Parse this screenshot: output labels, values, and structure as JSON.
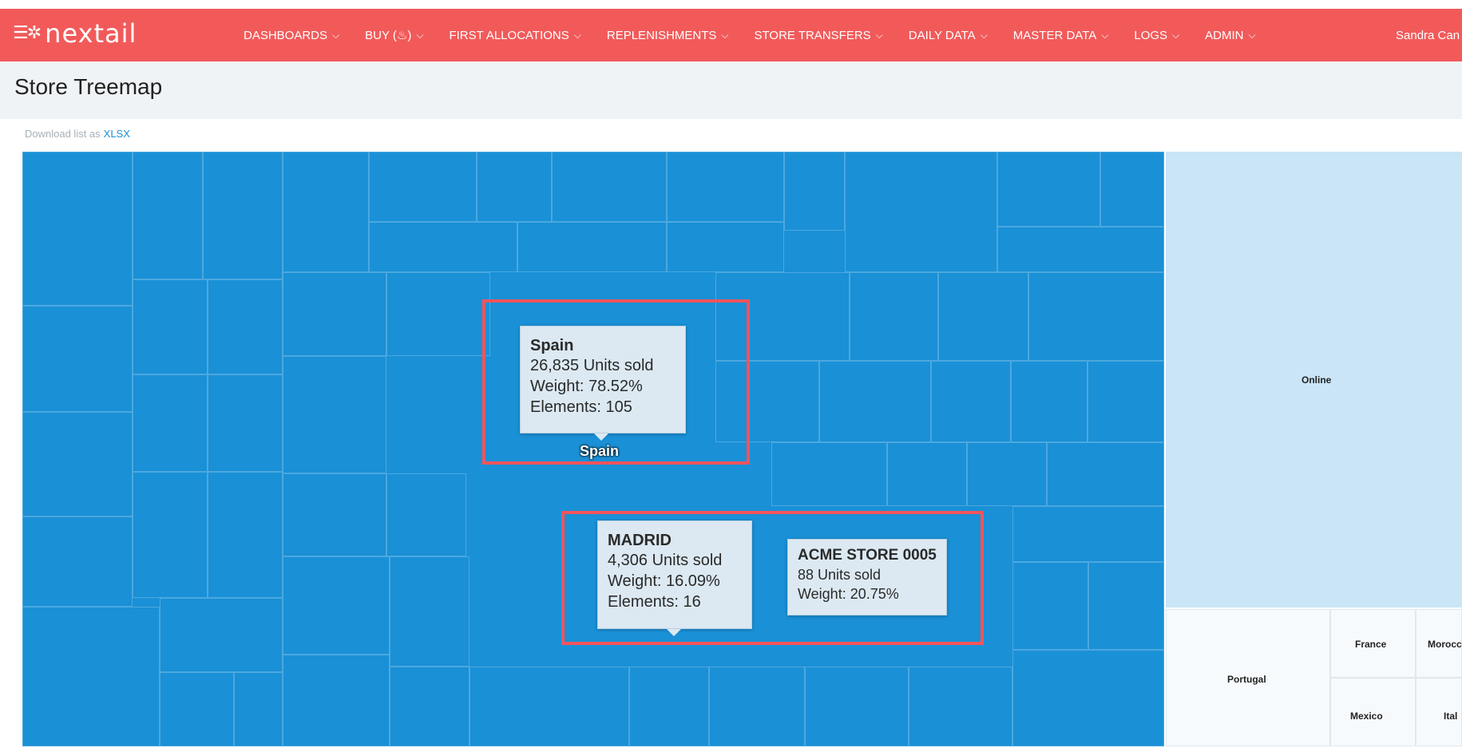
{
  "brand": {
    "name": "nextail",
    "icon": "logo-icon"
  },
  "nav": {
    "items": [
      {
        "label": "DASHBOARDS"
      },
      {
        "label": "BUY (♨)"
      },
      {
        "label": "FIRST ALLOCATIONS"
      },
      {
        "label": "REPLENISHMENTS"
      },
      {
        "label": "STORE TRANSFERS"
      },
      {
        "label": "DAILY DATA"
      },
      {
        "label": "MASTER DATA"
      },
      {
        "label": "LOGS"
      },
      {
        "label": "ADMIN"
      }
    ],
    "user": "Sandra Can"
  },
  "page": {
    "title": "Store Treemap",
    "download_prefix": "Download list as",
    "download_link": "XLSX"
  },
  "treemap": {
    "regions": [
      {
        "label": "Online"
      },
      {
        "label": "Portugal"
      },
      {
        "label": "France"
      },
      {
        "label": "Morocc"
      },
      {
        "label": "Mexico"
      },
      {
        "label": "Ital"
      }
    ],
    "spain_label": "Spain",
    "tooltips": {
      "spain": {
        "title": "Spain",
        "units": "26,835 Units sold",
        "weight": "Weight: 78.52%",
        "elements": "Elements: 105"
      },
      "madrid": {
        "title": "MADRID",
        "units": "4,306 Units sold",
        "weight": "Weight: 16.09%",
        "elements": "Elements: 16"
      },
      "store": {
        "title": "ACME STORE 0005",
        "units": "88 Units sold",
        "weight": "Weight: 20.75%"
      }
    }
  },
  "colors": {
    "nav": "#f25a5a",
    "spain": "#1a90d6",
    "online": "#c9e5f6",
    "highlight": "#f2545b"
  }
}
